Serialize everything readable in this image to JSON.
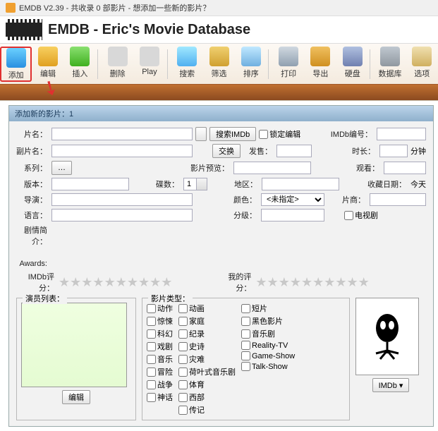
{
  "window": {
    "title": "EMDB V2.39 - 共收录 0 部影片 - 想添加一些新的影片？"
  },
  "header": {
    "title": "EMDB - Eric's Movie Database"
  },
  "toolbar": {
    "items": [
      {
        "label": "添加"
      },
      {
        "label": "编辑"
      },
      {
        "label": "插入"
      },
      {
        "label": "删除"
      },
      {
        "label": "Play"
      },
      {
        "label": "搜索"
      },
      {
        "label": "筛选"
      },
      {
        "label": "排序"
      },
      {
        "label": "打印"
      },
      {
        "label": "导出"
      },
      {
        "label": "硬盘"
      },
      {
        "label": "数据库"
      },
      {
        "label": "选项"
      }
    ]
  },
  "dialog": {
    "title": "添加新的影片：1",
    "labels": {
      "movie_name": "片名：",
      "alt_name": "副片名：",
      "series": "系列：",
      "version": "版本：",
      "director": "导演：",
      "language": "语言：",
      "plot": "剧情简介：",
      "awards": "Awards:",
      "imdb_rating": "IMDb评分：",
      "my_rating": "我的评分：",
      "search_imdb": "搜索IMDb",
      "swap": "交换",
      "lock_edit": "锁定编辑",
      "imdb_no": "IMDb编号：",
      "release": "发售：",
      "duration": "时长：",
      "minutes": "分钟",
      "preview": "影片预览：",
      "watched": "观看：",
      "discs": "碟数：",
      "disc_value": "1",
      "region": "地区：",
      "fav_date": "收藏日期：",
      "today": "今天",
      "color": "颜色：",
      "color_value": "<未指定>",
      "studio": "片商：",
      "rating_grade": "分级：",
      "tv": "电视剧",
      "dots": "…",
      "edit_btn": "编辑",
      "imdb_btn": "IMDb"
    },
    "groups": {
      "actors": "演员列表：",
      "genres": "影片类型："
    },
    "genres": {
      "col1": [
        "动作",
        "惊悚",
        "科幻",
        "戏剧",
        "音乐",
        "冒险",
        "战争",
        "神话"
      ],
      "col2": [
        "动画",
        "家庭",
        "纪录",
        "史诗",
        "灾难",
        "荷叶式音乐剧",
        "体育",
        "西部",
        "传记"
      ],
      "col3": [
        "短片",
        "黑色影片",
        "音乐剧",
        "Reality-TV",
        "Game-Show",
        "Talk-Show"
      ]
    }
  }
}
